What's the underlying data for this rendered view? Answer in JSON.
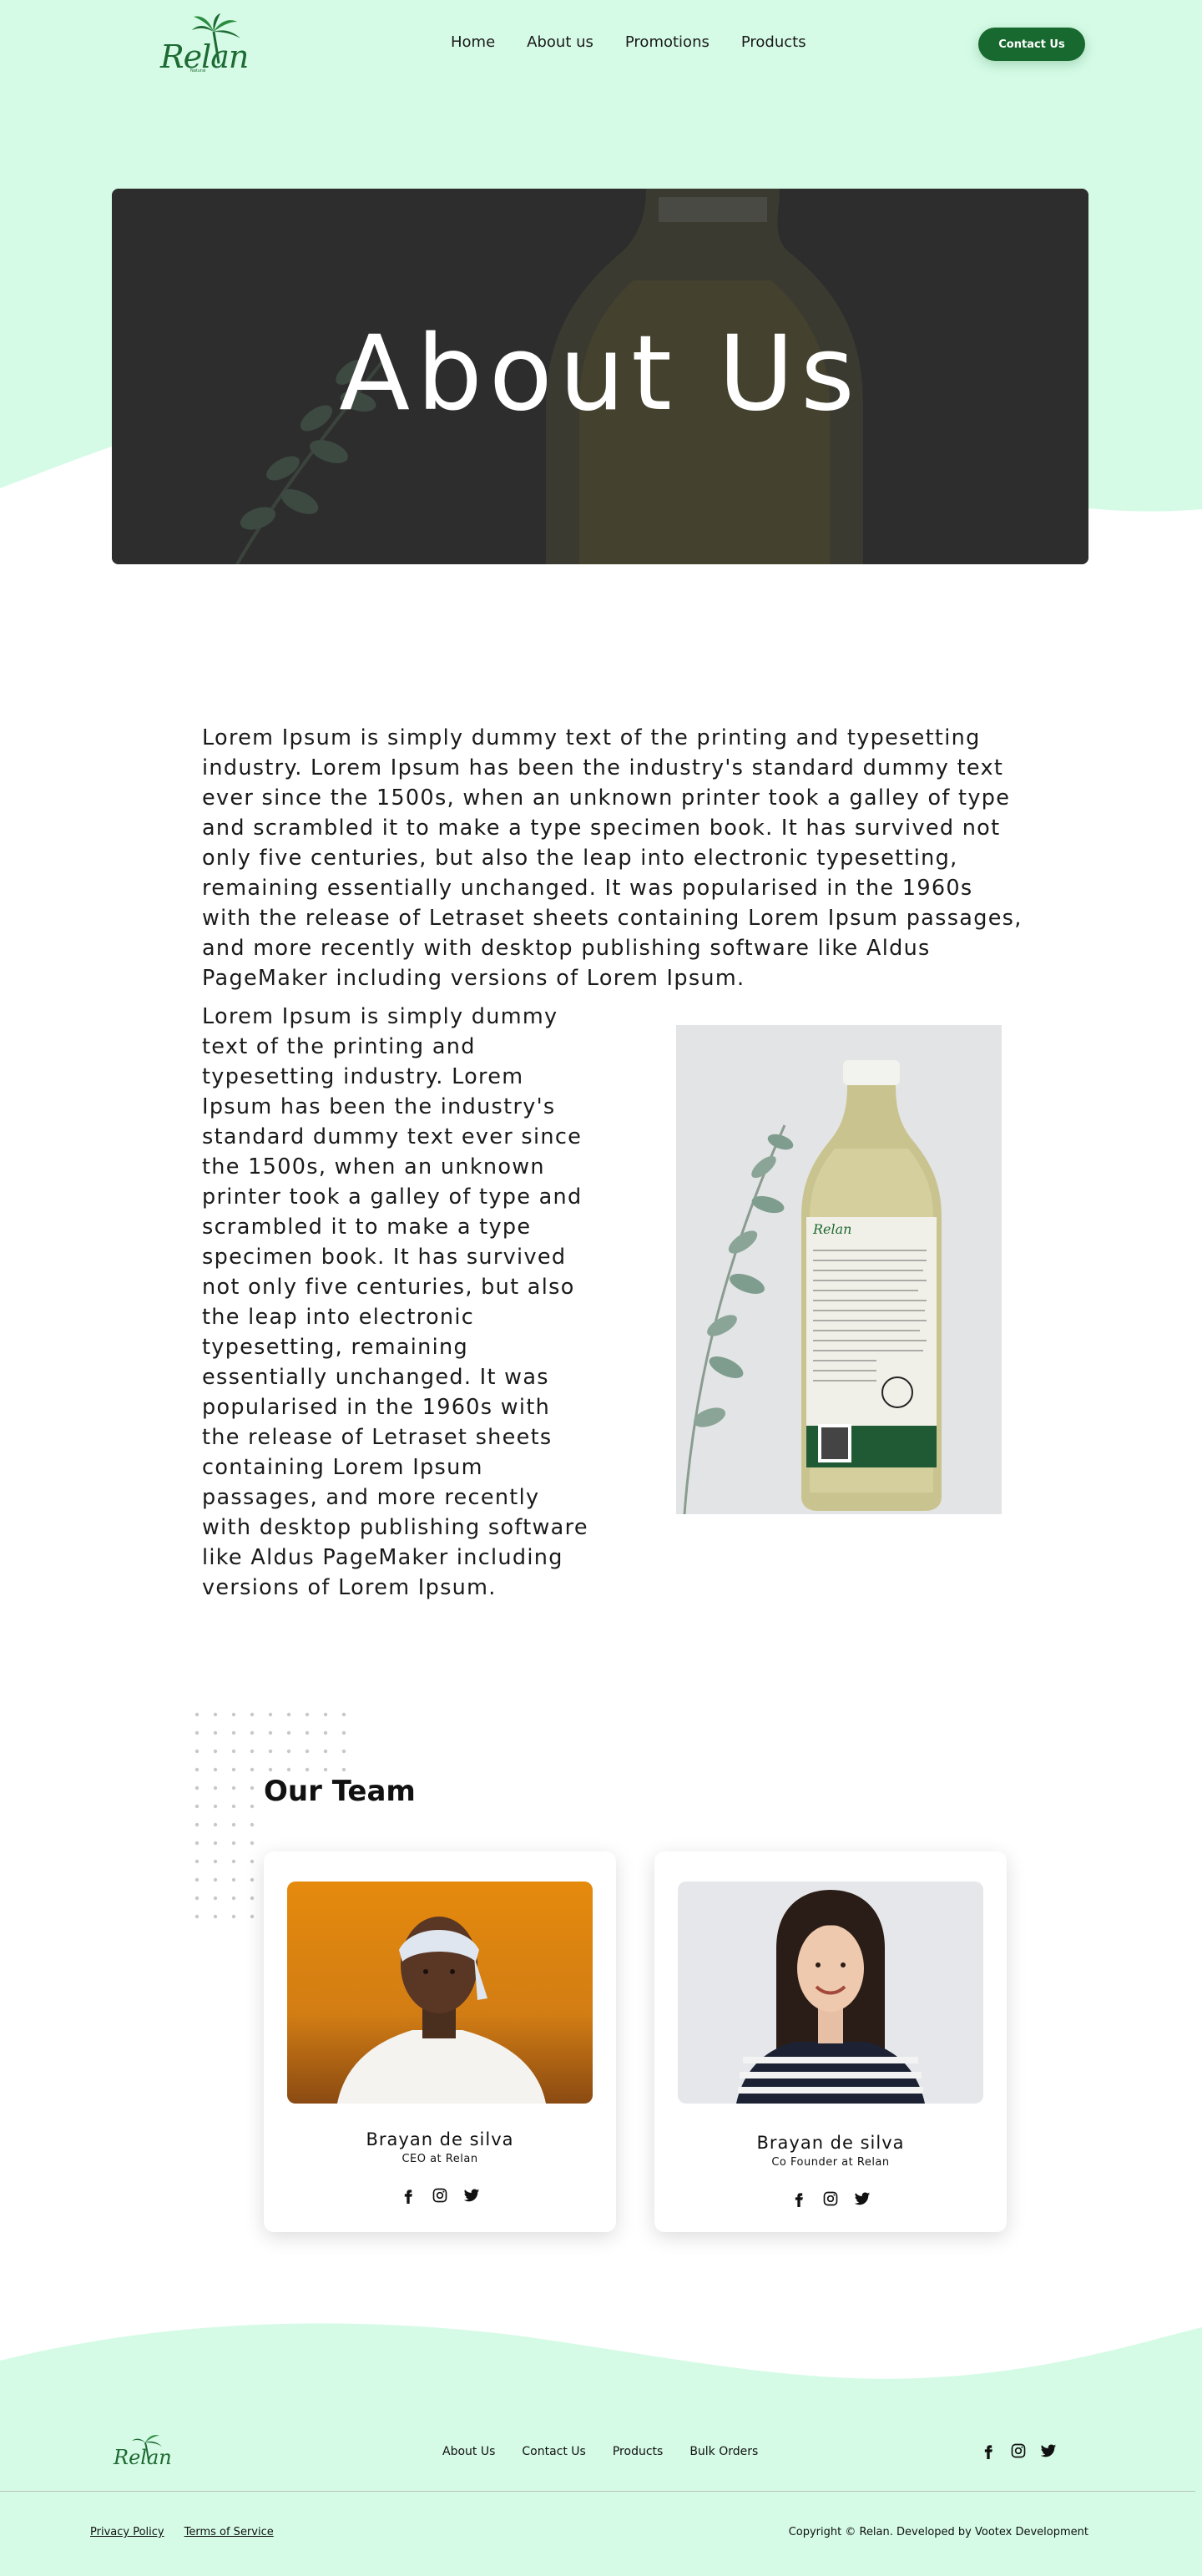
{
  "colors": {
    "mint": "#d5fbe6",
    "brand_green": "#18692f",
    "banner_overlay": "#2e2e2e"
  },
  "header": {
    "logo_text": "Relan",
    "logo_subtext": "Natural",
    "nav": [
      "Home",
      "About us",
      "Promotions",
      "Products"
    ],
    "contact_button": "Contact Us"
  },
  "banner": {
    "title": "About Us"
  },
  "intro": {
    "paragraph_1": "Lorem Ipsum is simply dummy text of the printing and typesetting industry. Lorem Ipsum has been the industry's standard dummy text ever since the 1500s, when an unknown printer took a galley of type and scrambled it to make a type specimen book. It has survived not only five centuries, but also the leap into electronic typesetting, remaining essentially unchanged. It was popularised in the 1960s with the release of Letraset sheets containing Lorem Ipsum passages, and more recently with desktop publishing software like Aldus PageMaker including versions of Lorem Ipsum.",
    "paragraph_2": "Lorem Ipsum is simply dummy text of the printing and typesetting industry. Lorem Ipsum has been the industry's standard dummy text ever since the 1500s, when an unknown printer took a galley of type and scrambled it to make a type specimen book. It has survived not only five centuries, but also the leap into electronic typesetting, remaining essentially unchanged. It was popularised in the 1960s with the release of Letraset sheets containing Lorem Ipsum passages, and more recently with desktop publishing software like Aldus PageMaker including versions of Lorem Ipsum.",
    "bottle_label": "Relan"
  },
  "team": {
    "title": "Our Team",
    "members": [
      {
        "name": "Brayan de silva",
        "role": "CEO at Relan",
        "socials": [
          "facebook-icon",
          "instagram-icon",
          "twitter-icon"
        ]
      },
      {
        "name": "Brayan de silva",
        "role": "Co Founder at Relan",
        "socials": [
          "facebook-icon",
          "instagram-icon",
          "twitter-icon"
        ]
      }
    ]
  },
  "footer": {
    "logo_text": "Relan",
    "links": [
      "About Us",
      "Contact Us",
      "Products",
      "Bulk Orders"
    ],
    "socials": [
      "facebook-icon",
      "instagram-icon",
      "twitter-icon"
    ],
    "legal": [
      "Privacy Policy",
      "Terms of Service"
    ],
    "copyright": "Copyright © Relan. Developed by Vootex Development"
  }
}
